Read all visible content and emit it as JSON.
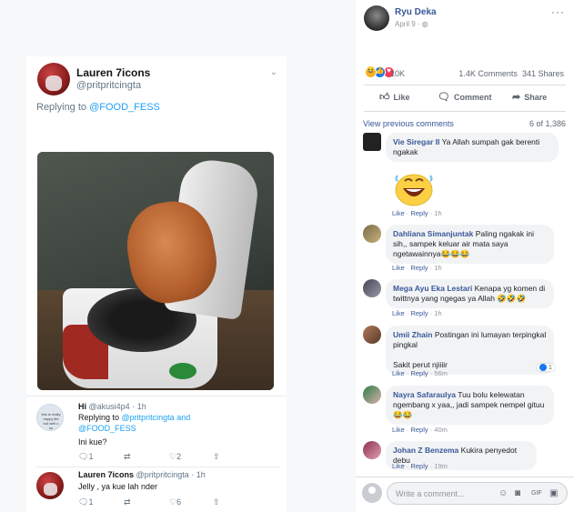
{
  "tweet": {
    "author_name": "Lauren 7icons",
    "author_handle": "@pritpritcingta",
    "replying_prefix": "Replying to ",
    "replying_mention": "@FOOD_FESS",
    "replies": [
      {
        "name": "Hi",
        "handle": "@akusi4p4",
        "time": "1h",
        "replying_prefix": "Replying to ",
        "mention1": "@pritpritcingta",
        "and_text": " and",
        "mention2": "@FOOD_FESS",
        "text": "Ini kue?",
        "reply_count": "1",
        "like_count": "2",
        "avatar_text": "this is really happy life but well u no"
      },
      {
        "name": "Lauren 7icons",
        "handle": "@pritpritcingta",
        "time": "1h",
        "text": "Jelly , ya kue lah nder",
        "reply_count": "1",
        "like_count": "6"
      }
    ]
  },
  "post": {
    "author": "Ryu Deka",
    "date": "April 9",
    "date_separator": " · ",
    "more_icon": "···",
    "reaction_count": "10K",
    "comments_count": "1.4K Comments",
    "shares_count": "341 Shares",
    "like_label": "Like",
    "comment_label": "Comment",
    "share_label": "Share",
    "view_previous": "View previous comments",
    "comment_pager": "6 of 1,386",
    "like_color": "#1877f2",
    "link_color": "#385898"
  },
  "comments": [
    {
      "name": "Vie Siregar II",
      "text": "Ya Allah sumpah gak berenti ngakak",
      "like": "Like",
      "reply": "Reply",
      "time": "1h"
    },
    {
      "name": "Dahliana Simanjuntak",
      "text": "Paling ngakak ini sih,, sampek keluar air mata saya ngetawainnya😂😂😂",
      "like": "Like",
      "reply": "Reply",
      "time": "1h"
    },
    {
      "name": "Mega Ayu Eka Lestari",
      "text": "Kenapa yg komen di twittnya yang ngegas ya Allah 🤣🤣🤣",
      "like": "Like",
      "reply": "Reply",
      "time": "1h"
    },
    {
      "name": "Umii Zhain",
      "text": "Postingan ini lumayan terpingkal pingkal",
      "text2": "Sakit perut njiiiir",
      "like": "Like",
      "reply": "Reply",
      "time": "56m",
      "reaction_count": "1"
    },
    {
      "name": "Nayra Safaraulya",
      "text": "Tuu bolu kelewatan ngembang x yaa,, jadi sampek nempel gituu 😂😂",
      "like": "Like",
      "reply": "Reply",
      "time": "40m"
    },
    {
      "name": "Johan Z Benzema",
      "text": "Kukira penyedot debu",
      "like": "Like",
      "reply": "Reply",
      "time": "19m"
    }
  ],
  "composer": {
    "placeholder": "Write a comment..."
  }
}
